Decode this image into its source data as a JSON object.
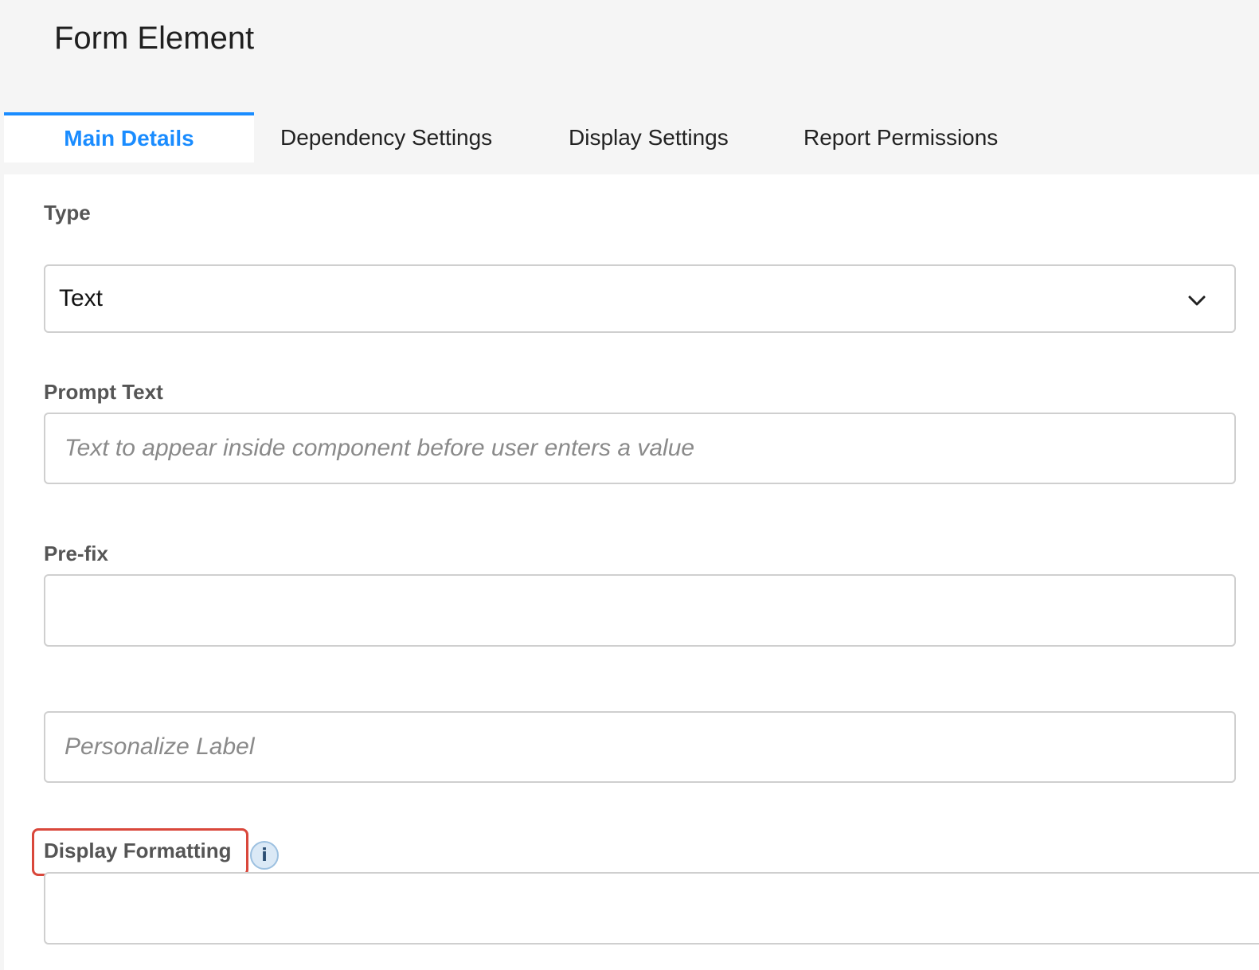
{
  "page": {
    "title": "Form Element"
  },
  "tabs": [
    {
      "label": "Main Details",
      "active": true
    },
    {
      "label": "Dependency Settings",
      "active": false
    },
    {
      "label": "Display Settings",
      "active": false
    },
    {
      "label": "Report Permissions",
      "active": false
    }
  ],
  "fields": {
    "type": {
      "label": "Type",
      "selected": "Text",
      "icon": "chevron-down-icon"
    },
    "prompt_text": {
      "label": "Prompt Text",
      "value": "",
      "placeholder": "Text to appear inside component before user enters a value"
    },
    "prefix": {
      "label": "Pre-fix",
      "value": "",
      "placeholder": ""
    },
    "personalize_label": {
      "value": "",
      "placeholder": "Personalize Label"
    },
    "display_formatting": {
      "label": "Display Formatting",
      "info_icon_glyph": "i",
      "icon": "info-icon",
      "value": ""
    }
  },
  "colors": {
    "accent": "#1a8cff",
    "highlight": "#d9473b",
    "label": "#555555",
    "border": "#cfcfcf",
    "background": "#f5f5f5"
  }
}
